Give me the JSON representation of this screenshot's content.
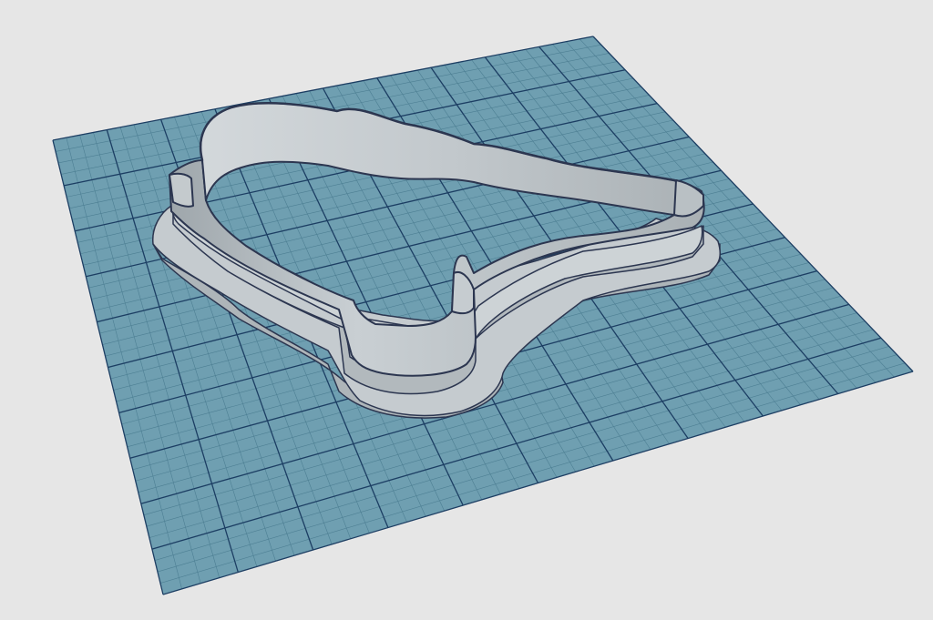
{
  "viewport": {
    "name": "3d-modeling-viewport",
    "background_color": "#e6e6e6",
    "grid": {
      "visible": true,
      "fill_color": "#6f9fb1",
      "minor_line_color": "#4d7f93",
      "major_line_color": "#1c3e63",
      "cells_per_side": 40,
      "major_every": 4
    },
    "model": {
      "object": "cookie-cutter",
      "wall_light_color": "#c9cfd3",
      "wall_mid_color": "#b3babe",
      "wall_dark_color": "#9aa1a5",
      "edge_color": "#2c3650"
    }
  }
}
